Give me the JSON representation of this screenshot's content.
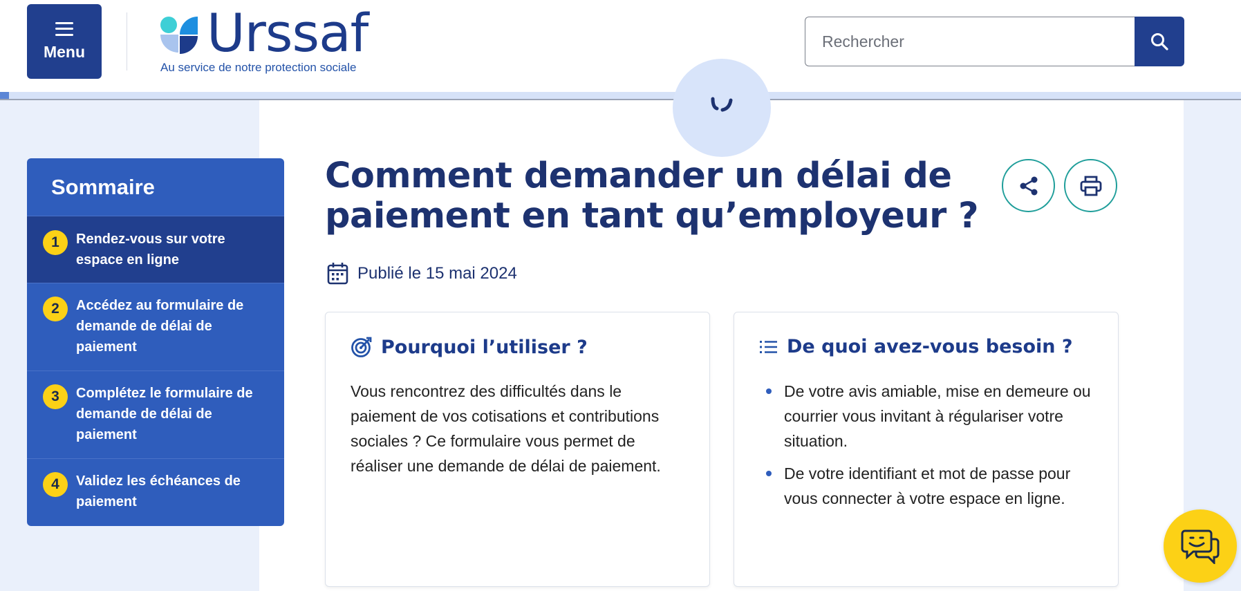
{
  "header": {
    "menu_label": "Menu",
    "logo_name": "Urssaf",
    "logo_tagline": "Au service de notre protection sociale",
    "search": {
      "placeholder": "Rechercher",
      "value": ""
    }
  },
  "progress": {
    "fraction": 0.007
  },
  "sommaire": {
    "title": "Sommaire",
    "items": [
      {
        "number": "1",
        "label": "Rendez-vous sur votre espace en ligne",
        "active": true
      },
      {
        "number": "2",
        "label": "Accédez au formulaire de demande de délai de paiement",
        "active": false
      },
      {
        "number": "3",
        "label": "Complétez le formulaire de demande de délai de paiement",
        "active": false
      },
      {
        "number": "4",
        "label": "Validez les échéances de paiement",
        "active": false
      }
    ]
  },
  "article": {
    "title": "Comment demander un délai de paiement en tant qu’employeur ?",
    "published": "Publié le 15 mai 2024"
  },
  "cards": {
    "why": {
      "heading": "Pourquoi l’utiliser ?",
      "text": "Vous rencontrez des difficultés dans le paiement de vos cotisations et contributions sociales ? Ce formulaire vous permet de réaliser une demande de délai de paiement."
    },
    "needs": {
      "heading": "De quoi avez-vous besoin ?",
      "items": [
        "De votre avis amiable, mise en demeure ou courrier vous invitant à régulariser votre situation.",
        "De votre identifiant et mot de passe pour vous connecter à votre espace en ligne."
      ]
    }
  },
  "icons": {
    "menu": "hamburger-icon",
    "search": "search-icon",
    "share": "share-icon",
    "print": "printer-icon",
    "calendar": "calendar-icon",
    "target": "target-icon",
    "list": "list-icon",
    "chat": "chatbot-icon"
  },
  "colors": {
    "primary": "#213f8e",
    "sommaire_bg": "#2f5dbc",
    "accent_yellow": "#fcd116",
    "teal": "#1f9e9a",
    "title": "#1d3270"
  }
}
